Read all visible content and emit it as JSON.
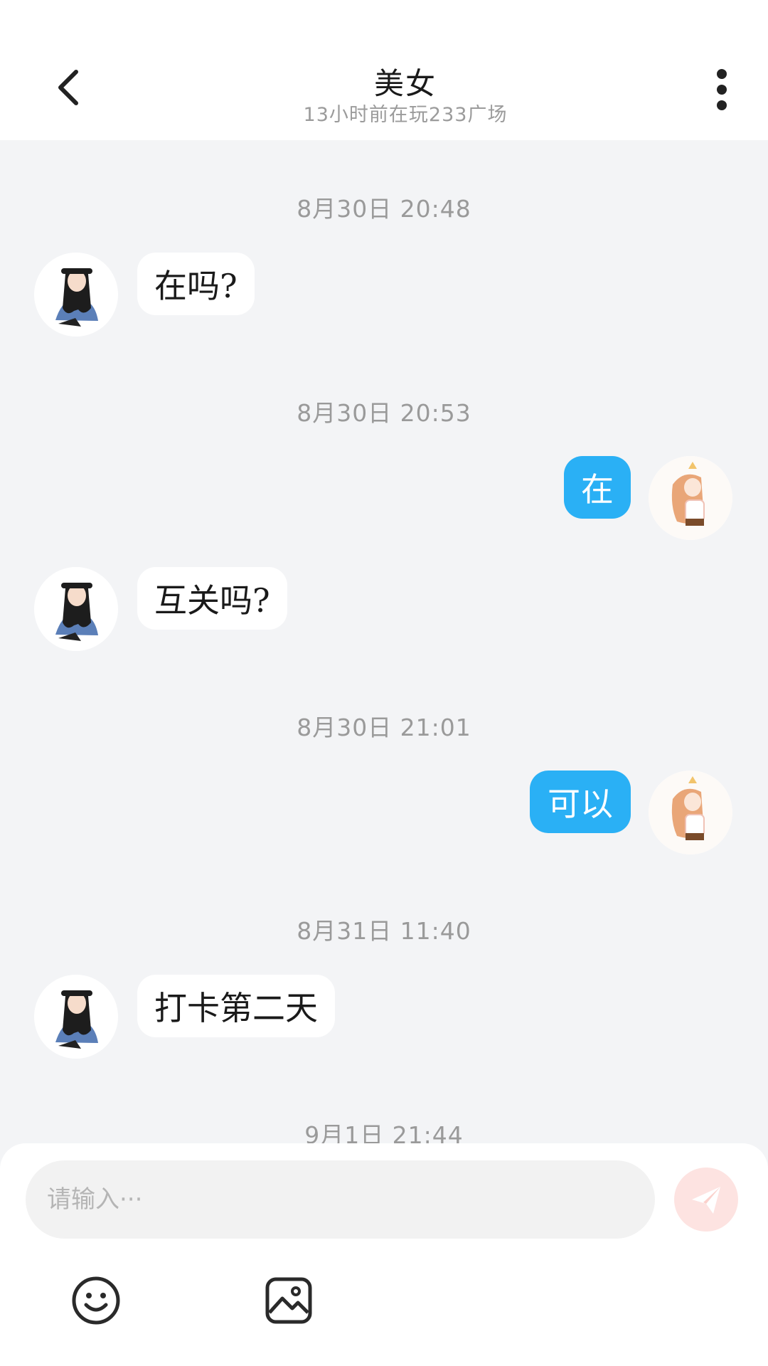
{
  "header": {
    "title": "美女",
    "subtitle": "13小时前在玩233广场"
  },
  "messages": [
    {
      "type": "time",
      "text": "8月30日 20:48"
    },
    {
      "type": "incoming",
      "text": "在吗?"
    },
    {
      "type": "time",
      "text": "8月30日 20:53"
    },
    {
      "type": "outgoing",
      "text": "在"
    },
    {
      "type": "incoming",
      "text": "互关吗?"
    },
    {
      "type": "time",
      "text": "8月30日 21:01"
    },
    {
      "type": "outgoing",
      "text": "可以"
    },
    {
      "type": "time",
      "text": "8月31日 11:40"
    },
    {
      "type": "incoming",
      "text": "打卡第二天"
    },
    {
      "type": "time",
      "text": "9月1日 21:44"
    }
  ],
  "input": {
    "placeholder": "请输入···"
  },
  "colors": {
    "outgoing_bubble": "#2ab0f5",
    "incoming_bubble": "#ffffff",
    "send_button": "#fde3e1",
    "chat_background": "#f3f4f6"
  },
  "icons": {
    "back": "chevron-left-icon",
    "more": "more-vertical-icon",
    "send": "send-icon",
    "emoji": "emoji-icon",
    "image": "image-icon"
  }
}
